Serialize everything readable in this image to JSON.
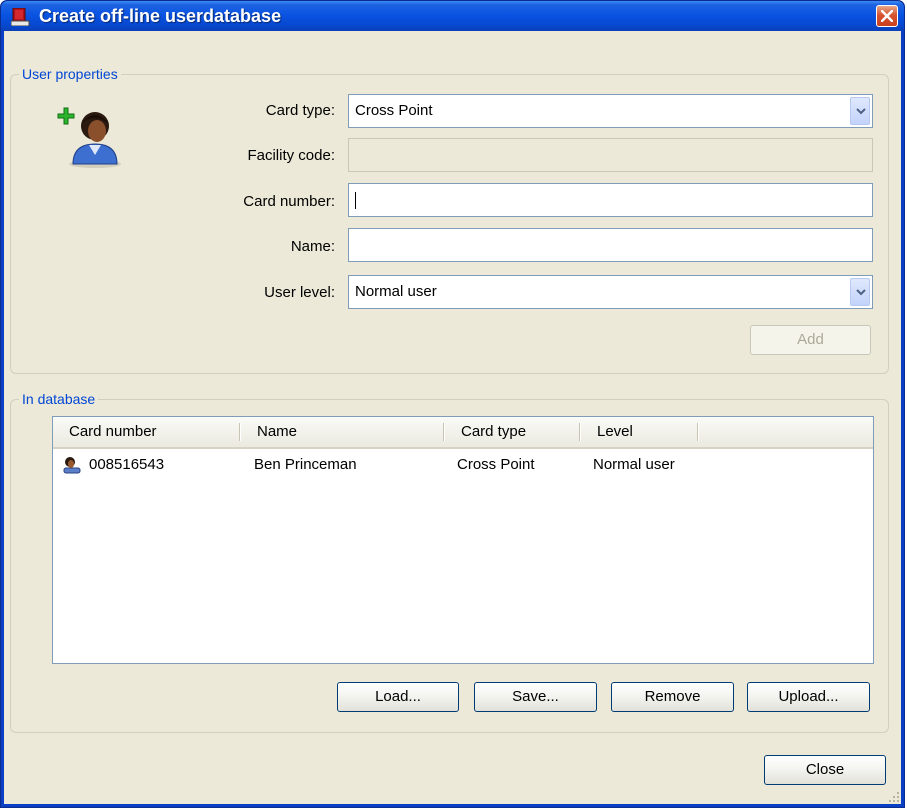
{
  "window": {
    "title": "Create off-line userdatabase"
  },
  "user_properties": {
    "legend": "User properties",
    "card_type": {
      "label": "Card type:",
      "value": "Cross Point"
    },
    "facility_code": {
      "label": "Facility code:",
      "value": ""
    },
    "card_number": {
      "label": "Card number:",
      "value": ""
    },
    "name": {
      "label": "Name:",
      "value": ""
    },
    "user_level": {
      "label": "User level:",
      "value": "Normal user"
    },
    "add_label": "Add"
  },
  "in_database": {
    "legend": "In database",
    "columns": [
      "Card number",
      "Name",
      "Card type",
      "Level"
    ],
    "rows": [
      {
        "card_number": "008516543",
        "name": "Ben Princeman",
        "card_type": "Cross Point",
        "level": "Normal user"
      }
    ],
    "buttons": {
      "load": "Load...",
      "save": "Save...",
      "remove": "Remove",
      "upload": "Upload..."
    }
  },
  "close_label": "Close",
  "colors": {
    "titlebar": "#0a54e3",
    "legend_text": "#0046d5",
    "dialog_bg": "#ece9d8"
  }
}
